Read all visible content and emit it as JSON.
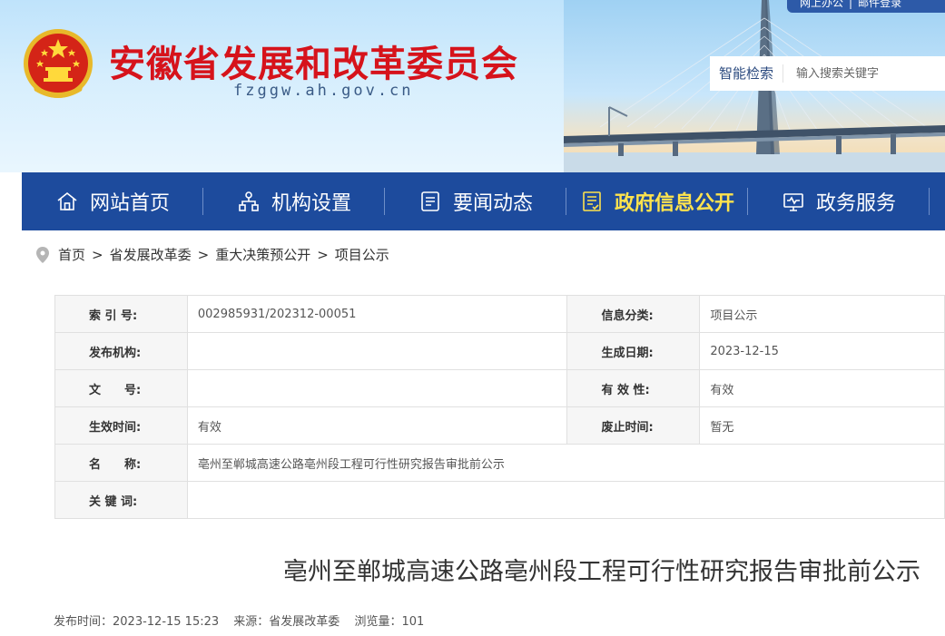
{
  "header": {
    "site_title": "安徽省发展和改革委员会",
    "site_domain": "fzggw.ah.gov.cn",
    "top_links": [
      "网上办公",
      "邮件登录"
    ],
    "search": {
      "label": "智能检索",
      "placeholder": "输入搜索关键字"
    },
    "colors": {
      "title": "#d6131b",
      "nav_bg": "#1d4b9d",
      "nav_active": "#ffe34d"
    }
  },
  "nav": {
    "items": [
      {
        "label": "网站首页",
        "icon": "home-icon",
        "active": false
      },
      {
        "label": "机构设置",
        "icon": "org-chart-icon",
        "active": false
      },
      {
        "label": "要闻动态",
        "icon": "news-icon",
        "active": false
      },
      {
        "label": "政府信息公开",
        "icon": "document-icon",
        "active": true
      },
      {
        "label": "政务服务",
        "icon": "monitor-icon",
        "active": false
      }
    ]
  },
  "breadcrumb": {
    "icon": "location-pin-icon",
    "items": [
      "首页",
      "省发展改革委",
      "重大决策预公开",
      "项目公示"
    ],
    "separator": ">"
  },
  "info_table": {
    "rows": [
      [
        {
          "label": "索 引 号:",
          "value": "002985931/202312-00051"
        },
        {
          "label": "信息分类:",
          "value": "项目公示"
        }
      ],
      [
        {
          "label": "发布机构:",
          "value": ""
        },
        {
          "label": "生成日期:",
          "value": "2023-12-15"
        }
      ],
      [
        {
          "label": "文　　号:",
          "value": ""
        },
        {
          "label": "有 效 性:",
          "value": "有效"
        }
      ],
      [
        {
          "label": "生效时间:",
          "value": "有效"
        },
        {
          "label": "废止时间:",
          "value": "暂无"
        }
      ]
    ],
    "name_row": {
      "label": "名　　称:",
      "value": "亳州至郸城高速公路亳州段工程可行性研究报告审批前公示"
    },
    "keyword_row": {
      "label": "关 键 词:",
      "value": ""
    }
  },
  "article": {
    "title": "亳州至郸城高速公路亳州段工程可行性研究报告审批前公示",
    "meta": {
      "publish_time": "发布时间：2023-12-15 15:23",
      "source": "来源：省发展改革委",
      "views": "浏览量：101"
    }
  }
}
